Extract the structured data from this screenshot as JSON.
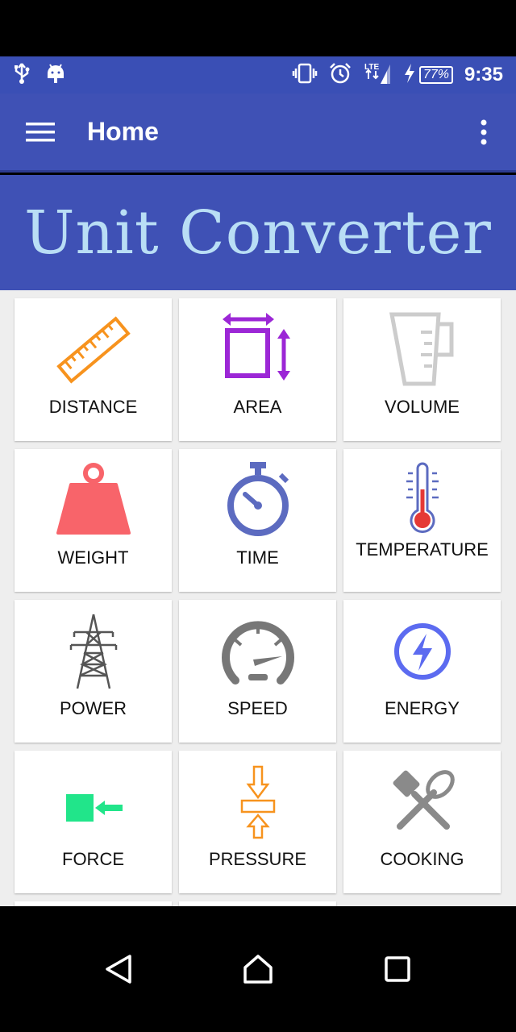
{
  "status_bar": {
    "icons_left": [
      "usb-icon",
      "android-icon"
    ],
    "icons_right": [
      "vibrate-icon",
      "alarm-icon",
      "lte-signal-icon",
      "charging-icon",
      "battery-icon"
    ],
    "network_label": "LTE",
    "battery": "77%",
    "time": "9:35"
  },
  "app_bar": {
    "title": "Home",
    "menu_icon": "hamburger-icon",
    "more_icon": "more-vert-icon"
  },
  "banner": {
    "title": "Unit Converter"
  },
  "colors": {
    "primary": "#3f51b5",
    "banner_text": "#b9def5",
    "distance": "#f7931e",
    "area": "#9c27d6",
    "volume": "#cccccc",
    "weight": "#f8646a",
    "time": "#5c6bc0",
    "temperature": "#e53935",
    "power": "#555555",
    "speed": "#777777",
    "energy": "#5c6bf0",
    "force": "#21e58a",
    "pressure": "#f7931e",
    "cooking": "#8a8a8a"
  },
  "tiles": [
    {
      "label": "DISTANCE",
      "icon": "ruler-icon"
    },
    {
      "label": "AREA",
      "icon": "area-icon"
    },
    {
      "label": "VOLUME",
      "icon": "measuring-cup-icon"
    },
    {
      "label": "WEIGHT",
      "icon": "weight-icon"
    },
    {
      "label": "TIME",
      "icon": "stopwatch-icon"
    },
    {
      "label": "TEMPERATURE",
      "icon": "thermometer-icon"
    },
    {
      "label": "POWER",
      "icon": "power-tower-icon"
    },
    {
      "label": "SPEED",
      "icon": "speedometer-icon"
    },
    {
      "label": "ENERGY",
      "icon": "bolt-icon"
    },
    {
      "label": "FORCE",
      "icon": "force-icon"
    },
    {
      "label": "PRESSURE",
      "icon": "pressure-icon"
    },
    {
      "label": "COOKING",
      "icon": "cooking-icon"
    }
  ],
  "nav_bar": {
    "back_icon": "back-icon",
    "home_icon": "home-icon",
    "recents_icon": "recents-icon"
  }
}
